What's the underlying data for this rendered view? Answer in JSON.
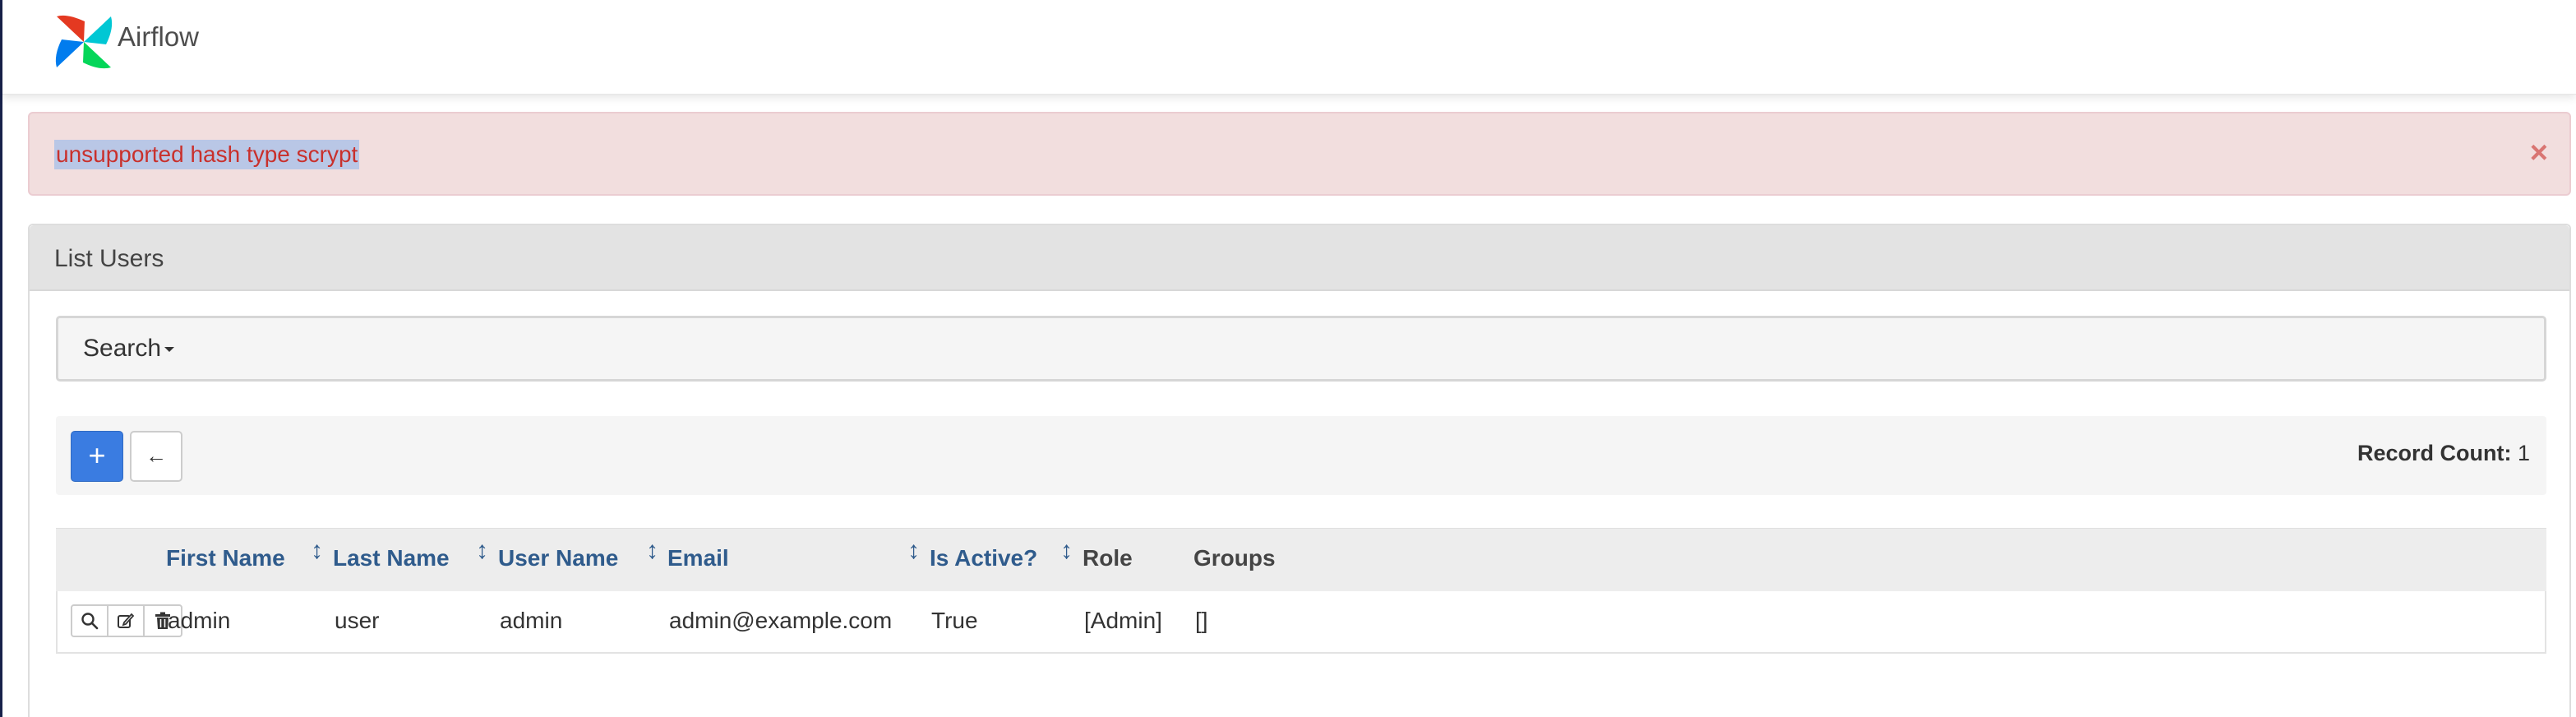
{
  "app": {
    "name": "Airflow",
    "logo_colors": [
      "#e43921",
      "#00c7d4",
      "#017cee",
      "#04d659"
    ]
  },
  "alert": {
    "message": "unsupported hash type scrypt",
    "close_icon": "close-icon",
    "close_symbol": "×"
  },
  "panel": {
    "title": "List Users"
  },
  "search": {
    "label": "Search"
  },
  "toolbar": {
    "add_symbol": "+",
    "back_symbol": "←",
    "record_count_label": "Record Count:",
    "record_count_value": "1"
  },
  "table": {
    "columns": [
      {
        "label": "First Name",
        "sortable": true
      },
      {
        "label": "Last Name",
        "sortable": true
      },
      {
        "label": "User Name",
        "sortable": true
      },
      {
        "label": "Email",
        "sortable": true
      },
      {
        "label": "Is Active?",
        "sortable": true
      },
      {
        "label": "Role",
        "sortable": false
      },
      {
        "label": "Groups",
        "sortable": false
      }
    ],
    "sort_symbol": "↕",
    "rows": [
      {
        "first_name": "admin",
        "last_name": "user",
        "user_name": "admin",
        "email": "admin@example.com",
        "is_active": "True",
        "role": "[Admin]",
        "groups": "[]"
      }
    ]
  },
  "colors": {
    "accent": "#3a7ce1",
    "alert_bg": "#f2dede",
    "alert_text": "#c9302c",
    "header_link": "#2f5b8c"
  }
}
